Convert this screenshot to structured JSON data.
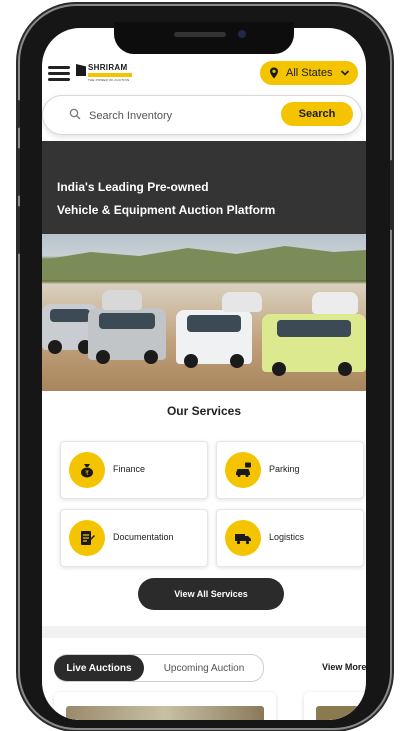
{
  "header": {
    "logo_text": "SHRIRAM",
    "logo_tagline": "THE POWER OF AUCTION",
    "states_label": "All States",
    "icons": [
      "hamburger-menu-icon",
      "location-pin-icon",
      "chevron-down-icon"
    ]
  },
  "search": {
    "placeholder": "Search Inventory",
    "value": "",
    "button_label": "Search",
    "icon": "search-icon"
  },
  "hero": {
    "line1": "India's Leading Pre-owned",
    "line2": "Vehicle & Equipment Auction Platform"
  },
  "services": {
    "title": "Our Services",
    "items": [
      {
        "label": "Finance",
        "icon": "money-bag-icon"
      },
      {
        "label": "Parking",
        "icon": "car-parking-icon"
      },
      {
        "label": "Documentation",
        "icon": "document-icon"
      },
      {
        "label": "Logistics",
        "icon": "truck-icon"
      }
    ],
    "view_all_label": "View All Services"
  },
  "auctions": {
    "tabs": [
      {
        "label": "Live Auctions",
        "active": true
      },
      {
        "label": "Upcoming Auction",
        "active": false
      }
    ],
    "view_more_label": "View More"
  },
  "colors": {
    "accent": "#f5c400",
    "dark": "#2b2b2b",
    "hero_bg": "#343434"
  }
}
